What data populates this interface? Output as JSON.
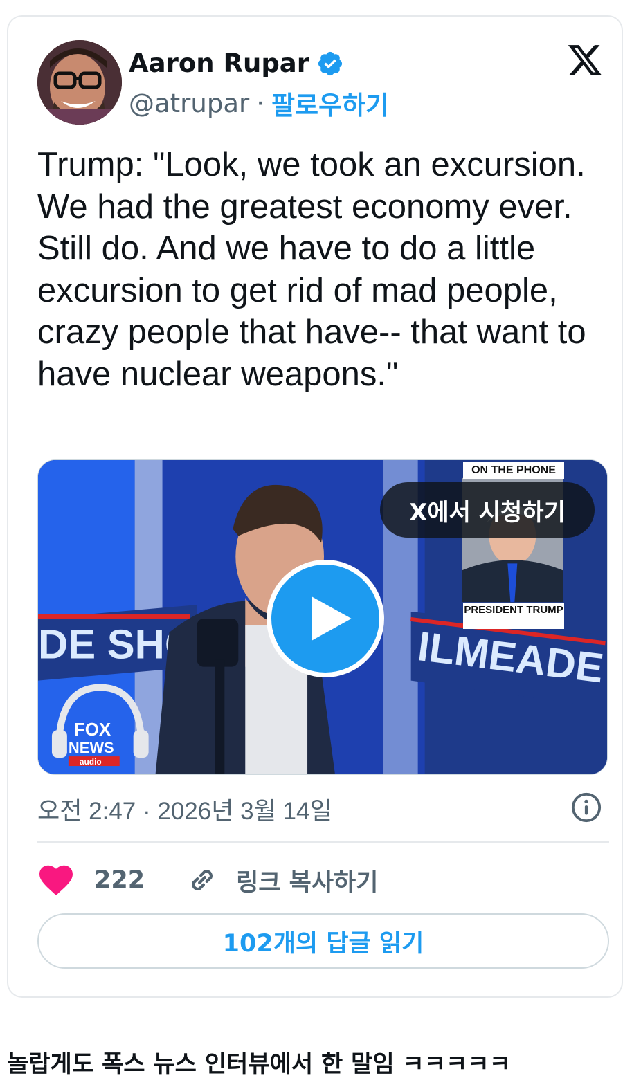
{
  "tweet": {
    "author_name": "Aaron Rupar",
    "author_handle": "@atrupar",
    "separator": "·",
    "follow_label": "팔로우하기",
    "text": "Trump: \"Look, we took an excursion. We had the greatest economy ever. Still do. And we have to do a little excursion to get rid of mad people, crazy people that have-- that want to have nuclear weapons.\"",
    "timestamp": "오전 2:47 · 2026년 3월 14일",
    "like_count": "222",
    "copy_link_label": "링크 복사하기",
    "read_replies_label": "102개의 답글 읽기"
  },
  "video": {
    "watch_on_x_label": "X에서 시청하기",
    "on_phone_banner": "ON THE PHONE",
    "caller_label": "PRESIDENT TRUMP",
    "show_banner_left": "DE SHOW",
    "show_banner_right": "ILMEADE SHOW",
    "network_logo": "FOX NEWS audio"
  },
  "caption": "놀랍게도 폭스 뉴스 인터뷰에서 한 말임 ㅋㅋㅋㅋㅋ",
  "icons": {
    "verified": "verified-badge-icon",
    "brand": "x-logo-icon",
    "info": "info-icon",
    "like": "heart-icon",
    "link": "link-icon",
    "play": "play-icon"
  },
  "colors": {
    "accent": "#1d9bf0",
    "like": "#f91880",
    "text_primary": "#0f1419",
    "text_secondary": "#536471",
    "border": "#e6e9ec"
  }
}
